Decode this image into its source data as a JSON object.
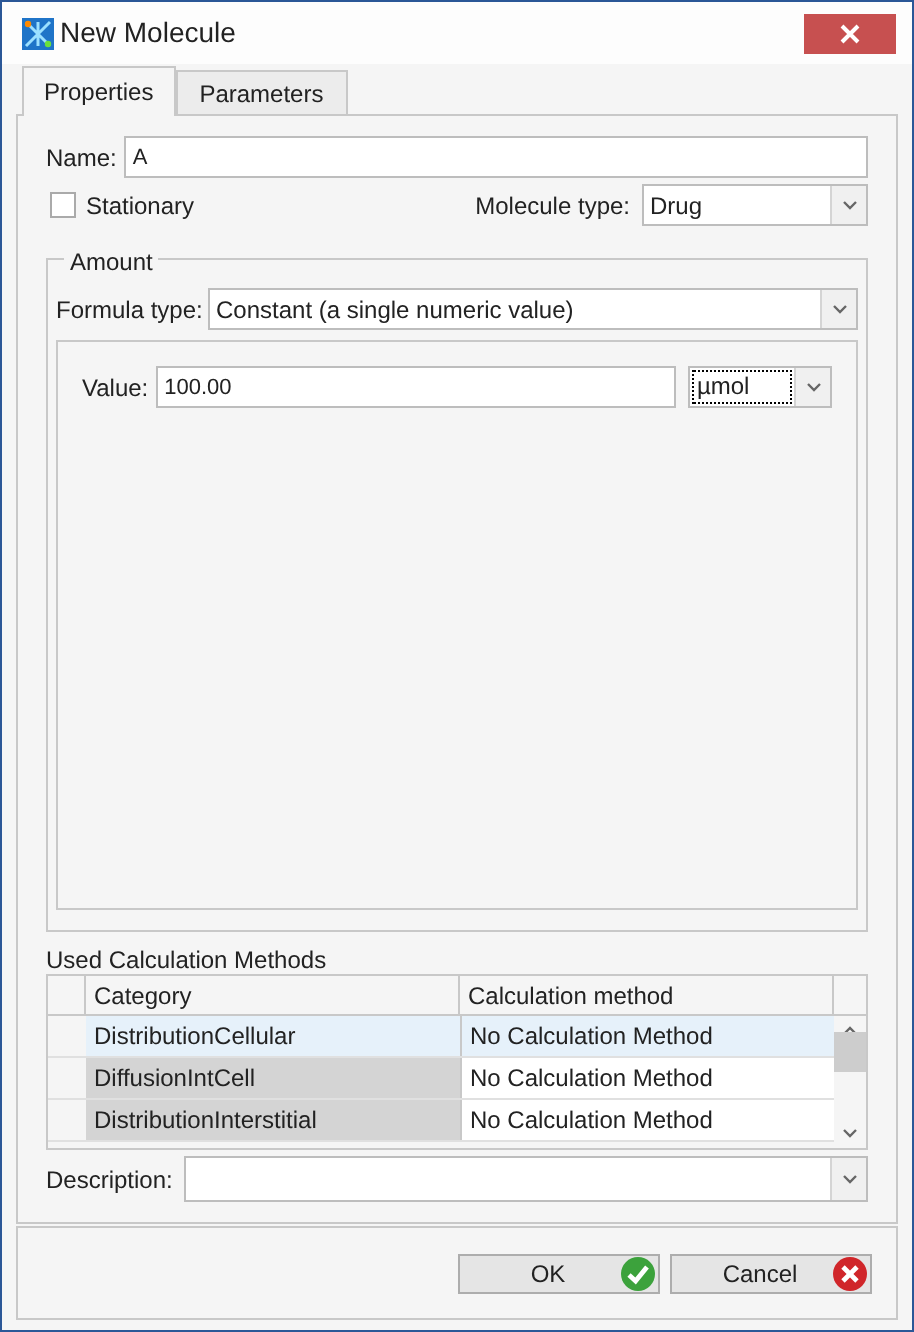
{
  "window": {
    "title": "New Molecule"
  },
  "tabs": [
    {
      "label": "Properties",
      "selected": true
    },
    {
      "label": "Parameters",
      "selected": false
    }
  ],
  "name": {
    "label": "Name:",
    "value": "A"
  },
  "stationary": {
    "label": "Stationary",
    "checked": false
  },
  "molecule_type": {
    "label": "Molecule type:",
    "value": "Drug"
  },
  "amount": {
    "title": "Amount",
    "formula_type": {
      "label": "Formula type:",
      "value": "Constant (a single numeric value)"
    },
    "value": {
      "label": "Value:",
      "value": "100.00"
    },
    "unit": "µmol"
  },
  "calculation_methods": {
    "title": "Used Calculation Methods",
    "columns": [
      "Category",
      "Calculation method"
    ],
    "rows": [
      {
        "category": "DistributionCellular",
        "method": "No Calculation Method",
        "selected": true
      },
      {
        "category": "DiffusionIntCell",
        "method": "No Calculation Method",
        "selected": false
      },
      {
        "category": "DistributionInterstitial",
        "method": "No Calculation Method",
        "selected": false
      }
    ]
  },
  "description": {
    "label": "Description:"
  },
  "buttons": [
    {
      "label": "OK",
      "kind": "ok"
    },
    {
      "label": "Cancel",
      "kind": "cancel"
    }
  ]
}
